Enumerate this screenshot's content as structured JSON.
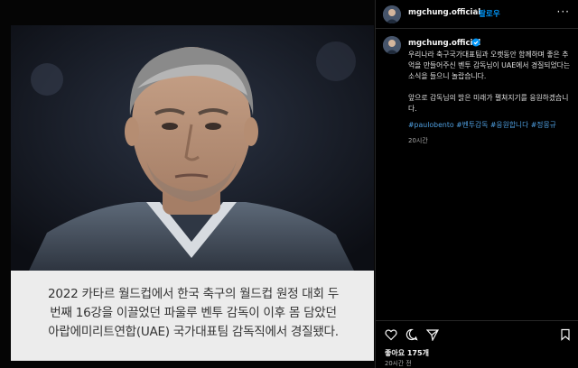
{
  "media": {
    "caption_lines": [
      "2022 카타르 월드컵에서 한국 축구의 월드컵 원정 대회 두",
      "번째 16강을 이끌었던 파울루 벤투 감독이 이후 몸 담았던",
      "아랍에미리트연합(UAE) 국가대표팀 감독직에서 경질됐다."
    ]
  },
  "post": {
    "username": "mgchung.official",
    "dot": "•",
    "follow_label": "팔로우",
    "more_label": "···",
    "caption_paragraph_1": "우리나라 축구국가대표팀과 오랫동안 함께하며 좋은 추억을 만들어주신 벤투 감독님이 UAE에서 경질되었다는 소식을 들으니 놀랍습니다.",
    "caption_paragraph_2": "앞으로 감독님의 밝은 미래가 펼쳐지기를 응원하겠습니다.",
    "hashtags": [
      "#paulobento",
      "#벤투감독",
      "#응원합니다",
      "#정몽규"
    ],
    "comment_time": "20시간",
    "likes": "좋아요 175개",
    "post_time": "20시간 전"
  },
  "colors": {
    "accent": "#0095f6",
    "hashtag": "#4f9fe0",
    "panel_bg": "#000000",
    "caption_bg": "#ececec"
  },
  "icons": {
    "like": "heart-icon",
    "comment": "comment-icon",
    "share": "paper-plane-icon",
    "save": "bookmark-icon",
    "verified": "verified-badge-icon"
  }
}
